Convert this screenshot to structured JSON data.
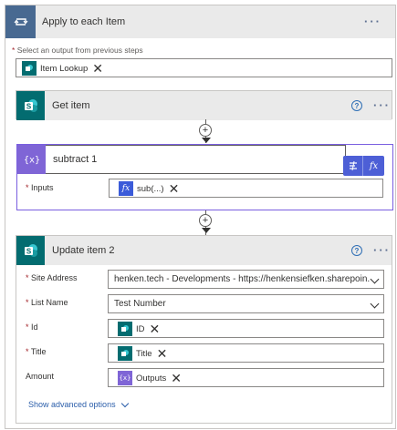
{
  "loop": {
    "title": "Apply to each Item",
    "menu": "···",
    "select_label": "Select an output from previous steps",
    "required_mark": "*",
    "token": "Item Lookup"
  },
  "get_item": {
    "title": "Get item",
    "help": "?",
    "menu": "···"
  },
  "subtract": {
    "title": "subtract 1",
    "inputs_label": "Inputs",
    "token": "sub(...)",
    "fx_label": "fx"
  },
  "update_item": {
    "title": "Update item 2",
    "help": "?",
    "menu": "···",
    "fields": {
      "site_address": {
        "label": "Site Address",
        "value": "henken.tech - Developments - https://henkensiefken.sharepoin..."
      },
      "list_name": {
        "label": "List Name",
        "value": "Test Number"
      },
      "id": {
        "label": "Id",
        "token": "ID"
      },
      "title": {
        "label": "Title",
        "token": "Title"
      },
      "amount": {
        "label": "Amount",
        "token": "Outputs"
      }
    },
    "show_advanced": "Show advanced options"
  },
  "colors": {
    "loop_badge": "#486991",
    "sharepoint": "#036c70",
    "variable": "#7f65d6",
    "focus_border": "#7a5fe0",
    "expression": "#3b5bd9",
    "link": "#2b5eaa"
  },
  "icons": {
    "loop": "loop-icon",
    "sharepoint": "sharepoint-icon",
    "variable": "variable-icon",
    "expression": "fx-icon"
  }
}
